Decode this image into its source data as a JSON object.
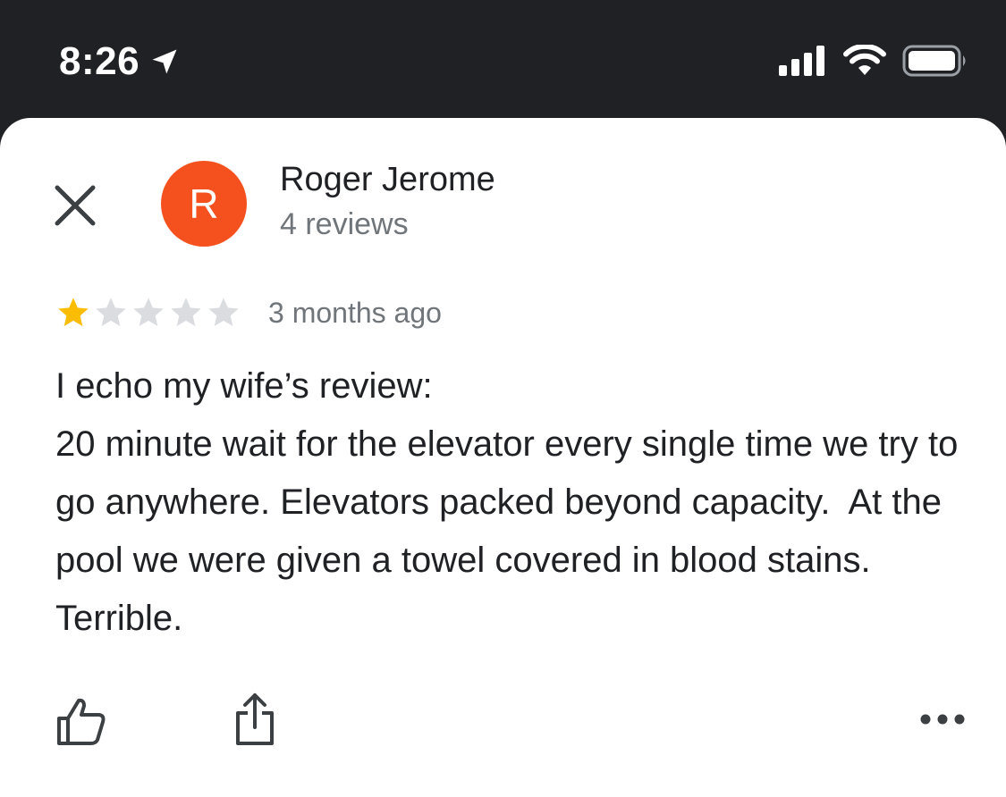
{
  "status_bar": {
    "time": "8:26"
  },
  "review": {
    "reviewer_initial": "R",
    "reviewer_name": "Roger Jerome",
    "review_count": "4 reviews",
    "rating": 1,
    "rating_max": 5,
    "date": "3 months ago",
    "text": "I echo my wife’s review:\n20 minute wait for the elevator every single time we try to go anywhere. Elevators packed beyond capacity.  At the pool we were given a towel covered in blood stains. Terrible."
  },
  "colors": {
    "avatar": "#f4511e",
    "star_filled": "#fbbc04",
    "star_empty": "#dadce0",
    "status_bar": "#202124"
  },
  "icons": {
    "close": "close-icon",
    "location": "location-arrow-icon",
    "signal": "cellular-signal-icon",
    "wifi": "wifi-icon",
    "battery": "battery-icon",
    "like": "thumb-up-icon",
    "share": "share-icon",
    "more": "more-horizontal-icon"
  }
}
